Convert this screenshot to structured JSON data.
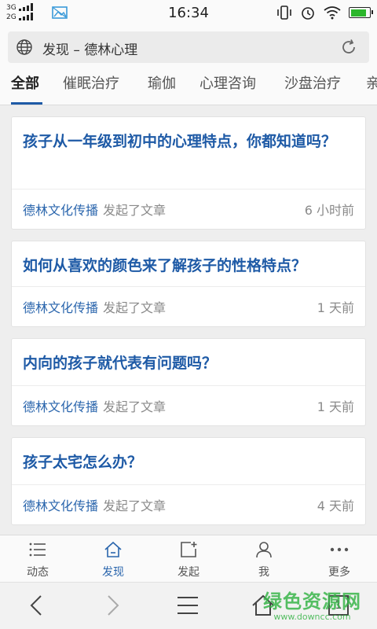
{
  "status_bar": {
    "network1": "3G",
    "network2": "2G",
    "time": "16:34"
  },
  "address_bar": {
    "title": "发现 – 德林心理"
  },
  "tabs": [
    {
      "label": "全部",
      "active": true
    },
    {
      "label": "催眠治疗",
      "active": false
    },
    {
      "label": "瑜伽",
      "active": false
    },
    {
      "label": "心理咨询",
      "active": false
    },
    {
      "label": "沙盘治疗",
      "active": false
    },
    {
      "label": "亲",
      "active": false
    }
  ],
  "articles": [
    {
      "title": "孩子从一年级到初中的心理特点，你都知道吗？",
      "author": "德林文化传播",
      "action": "发起了文章",
      "time": "6 小时前"
    },
    {
      "title": "如何从喜欢的颜色来了解孩子的性格特点？",
      "author": "德林文化传播",
      "action": "发起了文章",
      "time": "1 天前"
    },
    {
      "title": "内向的孩子就代表有问题吗？",
      "author": "德林文化传播",
      "action": "发起了文章",
      "time": "1 天前"
    },
    {
      "title": "孩子太宅怎么办？",
      "author": "德林文化传播",
      "action": "发起了文章",
      "time": "4 天前"
    }
  ],
  "bottom_nav": [
    {
      "label": "动态",
      "icon": "list-icon",
      "active": false
    },
    {
      "label": "发现",
      "icon": "home-icon",
      "active": true
    },
    {
      "label": "发起",
      "icon": "compose-icon",
      "active": false
    },
    {
      "label": "我",
      "icon": "person-icon",
      "active": false
    },
    {
      "label": "更多",
      "icon": "more-icon",
      "active": false
    }
  ],
  "system_bar": {
    "tab_count": "1"
  },
  "watermark": {
    "text": "绿色资源网",
    "url": "www.downcc.com"
  },
  "colors": {
    "accent": "#1e5aa6",
    "link": "#2b66ad",
    "battery": "#2bb62b",
    "watermark": "#39b54a"
  }
}
